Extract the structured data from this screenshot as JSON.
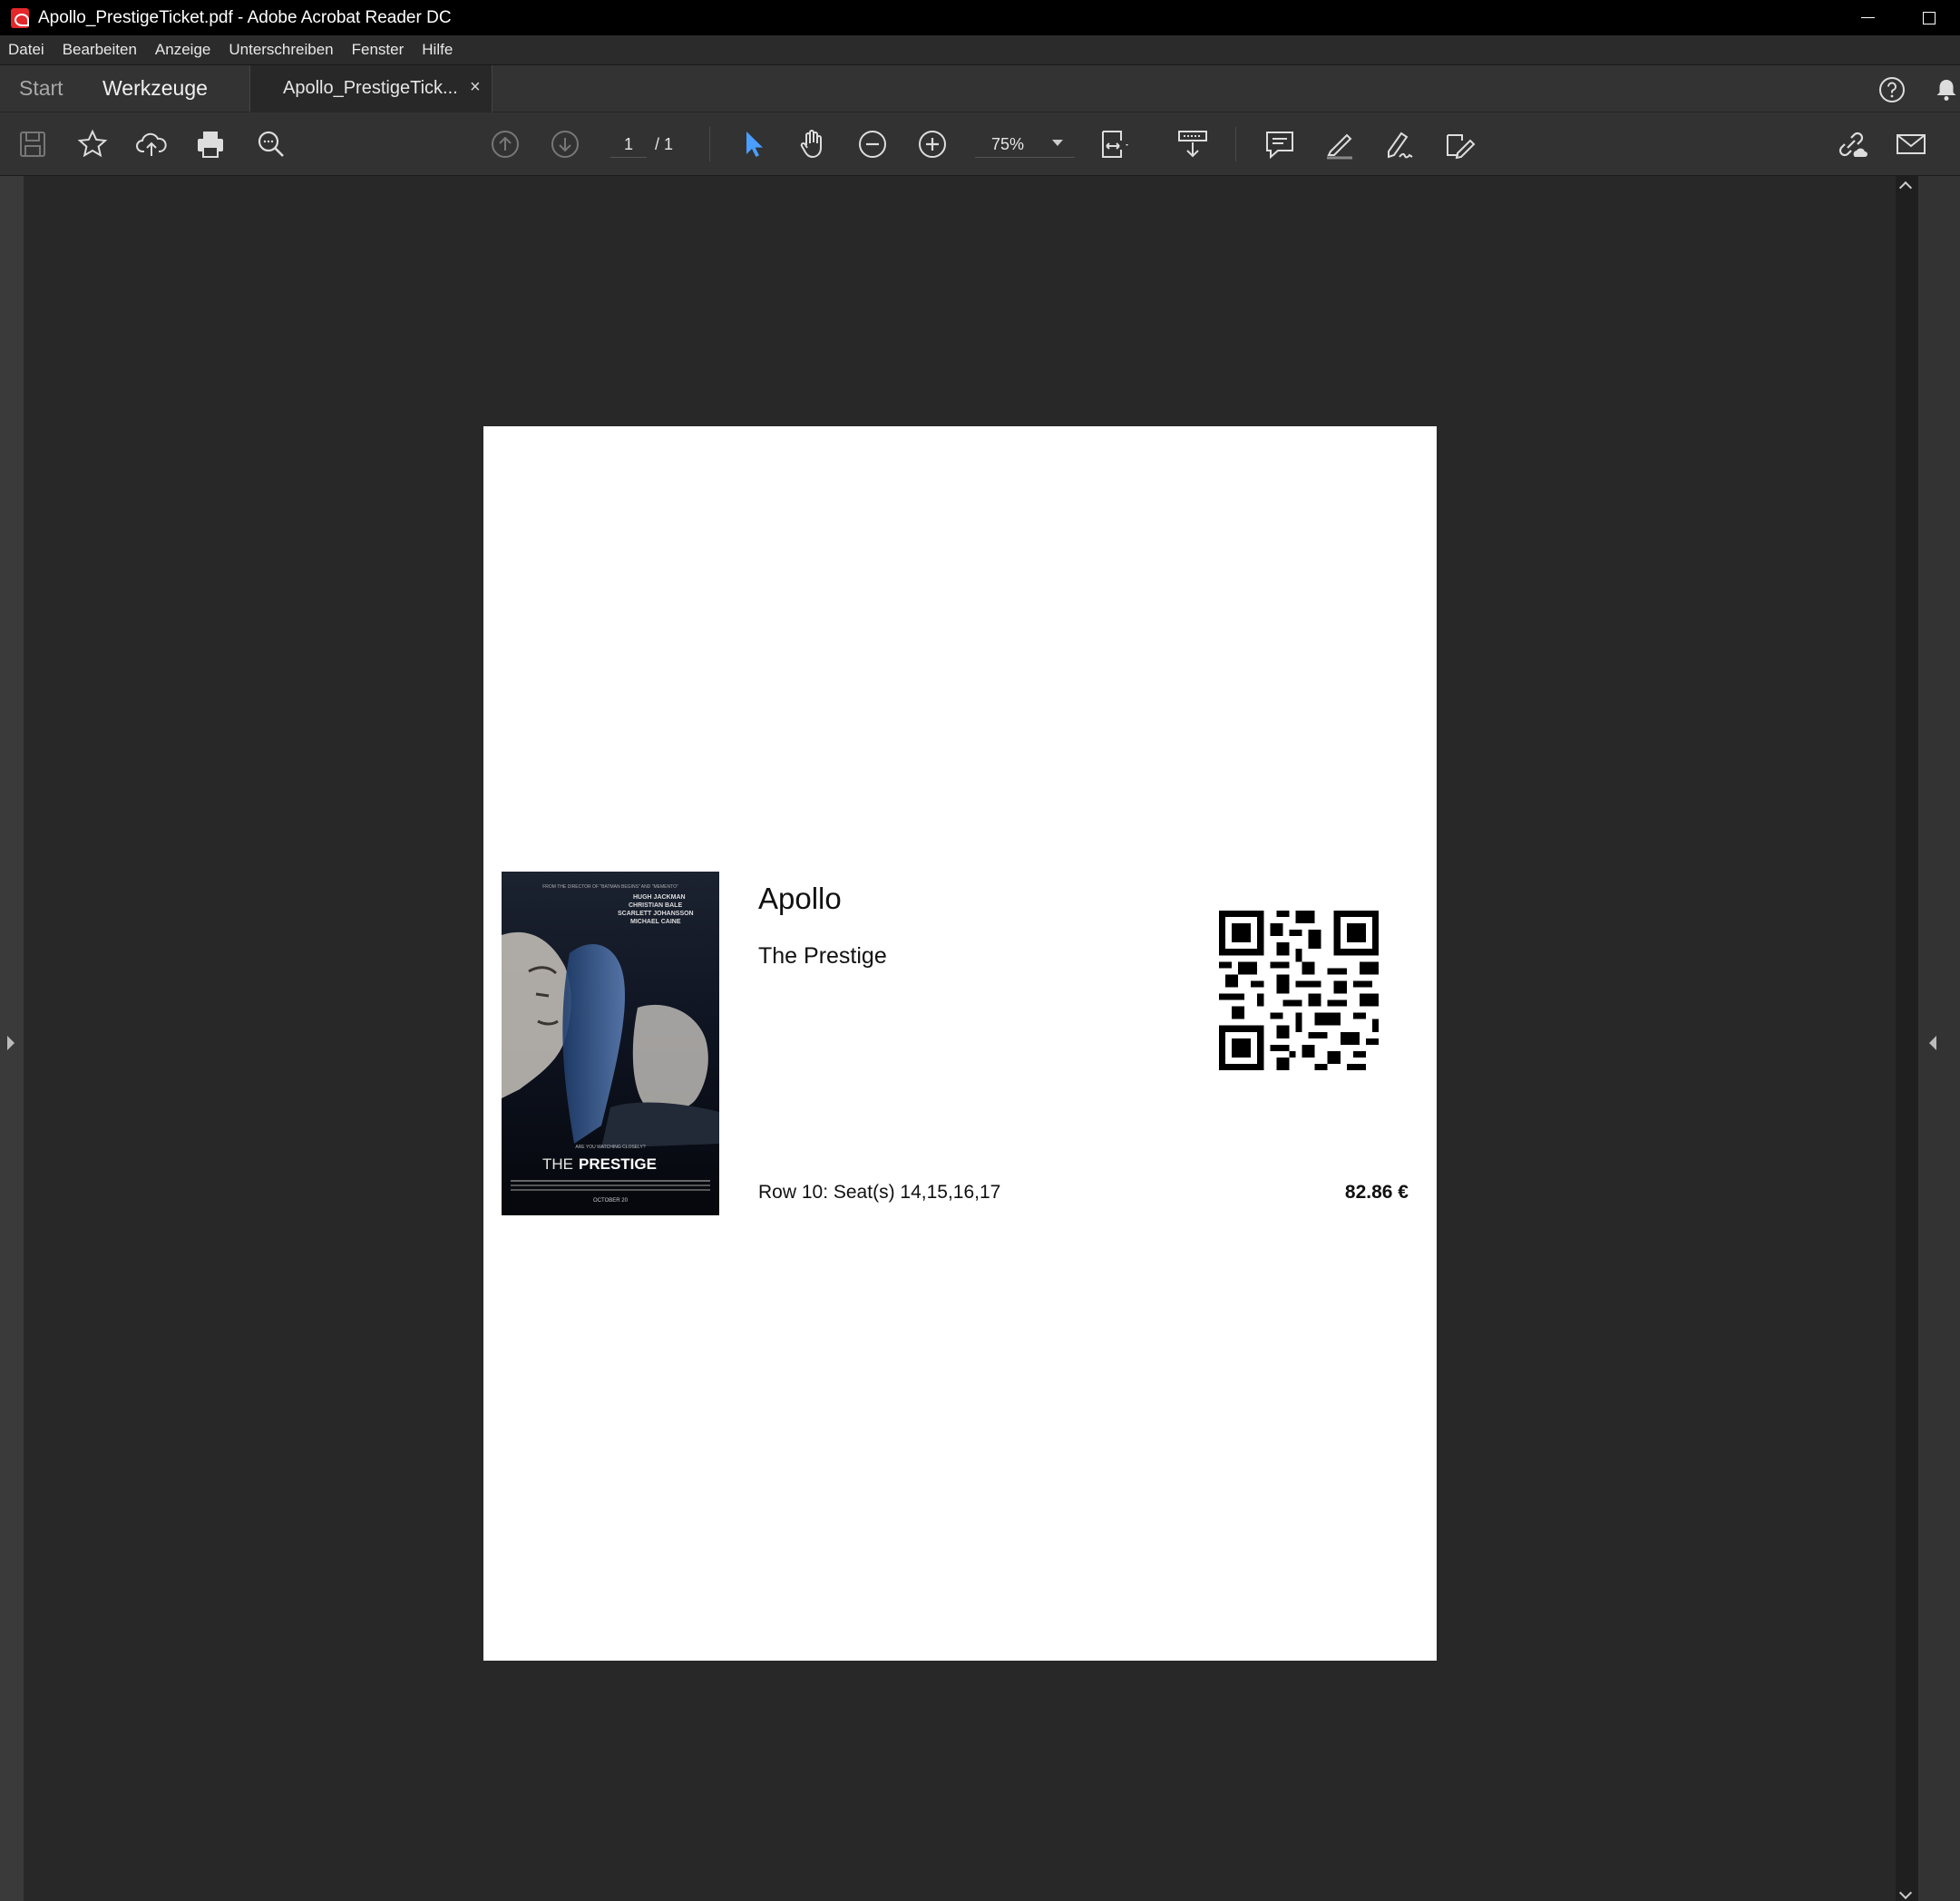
{
  "window": {
    "title": "Apollo_PrestigeTicket.pdf - Adobe Acrobat Reader DC"
  },
  "menu": {
    "items": [
      "Datei",
      "Bearbeiten",
      "Anzeige",
      "Unterschreiben",
      "Fenster",
      "Hilfe"
    ]
  },
  "tabs": {
    "start": "Start",
    "tools": "Werkzeuge",
    "document": "Apollo_PrestigeTick...",
    "close": "×"
  },
  "toolbar": {
    "page_current": "1",
    "page_total": "/ 1",
    "zoom": "75%",
    "icons": [
      "save-icon",
      "bookmark-star-icon",
      "upload-cloud-icon",
      "print-icon",
      "search-zoom-icon",
      "page-up-icon",
      "page-down-icon",
      "select-cursor-icon",
      "hand-icon",
      "zoom-out-icon",
      "zoom-in-icon",
      "fit-page-icon",
      "scroll-mode-icon",
      "comment-icon",
      "highlight-icon",
      "sign-icon",
      "edit-pdf-icon",
      "share-link-icon",
      "email-icon"
    ],
    "accent_color": "#4a9eff"
  },
  "ticket": {
    "venue": "Apollo",
    "movie": "The Prestige",
    "seats": "Row 10: Seat(s) 14,15,16,17",
    "price": "82.86 €",
    "poster": {
      "tagline_top": "FROM THE DIRECTOR OF \"BATMAN BEGINS\" AND \"MEMENTO\"",
      "cast": [
        "HUGH JACKMAN",
        "CHRISTIAN BALE",
        "SCARLETT JOHANSSON",
        "MICHAEL CAINE"
      ],
      "tagline": "ARE YOU WATCHING CLOSELY?",
      "title_the": "THE",
      "title_main": "PRESTIGE",
      "release": "OCTOBER 20"
    }
  }
}
